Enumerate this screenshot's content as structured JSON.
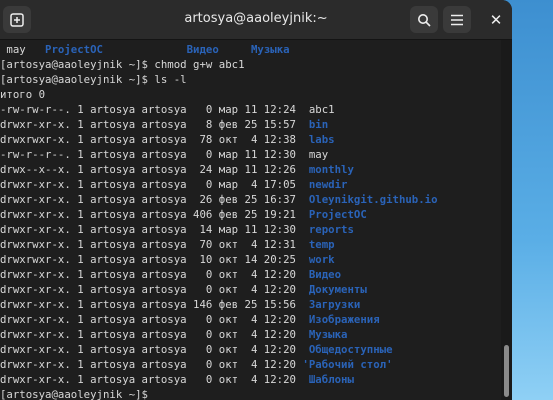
{
  "window": {
    "title": "artosya@aaoleyjnik:~",
    "icons": {
      "new_tab": "new-tab-icon",
      "search": "search-icon",
      "menu": "hamburger-menu-icon",
      "close": "close-icon"
    }
  },
  "colors": {
    "directory": "#2a63b8",
    "text": "#d8d8d8",
    "background": "#1e1e1e"
  },
  "terminal": {
    "lines": [
      [
        {
          "t": " may   "
        },
        {
          "t": "ProjectOC",
          "c": "blue"
        },
        {
          "t": "             "
        },
        {
          "t": "Видео",
          "c": "blue"
        },
        {
          "t": "     "
        },
        {
          "t": "Музыка",
          "c": "blue"
        }
      ],
      [
        {
          "t": "[artosya@aaoleyjnik ~]$ chmod g+w abc1"
        }
      ],
      [
        {
          "t": "[artosya@aaoleyjnik ~]$ ls -l"
        }
      ],
      [
        {
          "t": "итого 0"
        }
      ],
      [
        {
          "t": "-rw-rw-r--. 1 artosya artosya   0 мар 11 12:24  "
        },
        {
          "t": "abc1"
        }
      ],
      [
        {
          "t": "drwxr-xr-x. 1 artosya artosya   8 фев 25 15:57  "
        },
        {
          "t": "bin",
          "c": "blue"
        }
      ],
      [
        {
          "t": "drwxrwxr-x. 1 artosya artosya  78 окт  4 12:38  "
        },
        {
          "t": "labs",
          "c": "blue"
        }
      ],
      [
        {
          "t": "-rw-r--r--. 1 artosya artosya   0 мар 11 12:30  "
        },
        {
          "t": "may"
        }
      ],
      [
        {
          "t": "drwx--x--x. 1 artosya artosya  24 мар 11 12:26  "
        },
        {
          "t": "monthly",
          "c": "blue"
        }
      ],
      [
        {
          "t": "drwxr-xr-x. 1 artosya artosya   0 мар  4 17:05  "
        },
        {
          "t": "newdir",
          "c": "blue"
        }
      ],
      [
        {
          "t": "drwxr-xr-x. 1 artosya artosya  26 фев 25 16:37  "
        },
        {
          "t": "Oleynikgit.github.io",
          "c": "blue"
        }
      ],
      [
        {
          "t": "drwxr-xr-x. 1 artosya artosya 406 фев 25 19:21  "
        },
        {
          "t": "ProjectOC",
          "c": "blue"
        }
      ],
      [
        {
          "t": "drwxr-xr-x. 1 artosya artosya  14 мар 11 12:30  "
        },
        {
          "t": "reports",
          "c": "blue"
        }
      ],
      [
        {
          "t": "drwxrwxr-x. 1 artosya artosya  70 окт  4 12:31  "
        },
        {
          "t": "temp",
          "c": "blue"
        }
      ],
      [
        {
          "t": "drwxrwxr-x. 1 artosya artosya  10 окт 14 20:25  "
        },
        {
          "t": "work",
          "c": "blue"
        }
      ],
      [
        {
          "t": "drwxr-xr-x. 1 artosya artosya   0 окт  4 12:20  "
        },
        {
          "t": "Видео",
          "c": "blue"
        }
      ],
      [
        {
          "t": "drwxr-xr-x. 1 artosya artosya   0 окт  4 12:20  "
        },
        {
          "t": "Документы",
          "c": "blue"
        }
      ],
      [
        {
          "t": "drwxr-xr-x. 1 artosya artosya 146 фев 25 15:56  "
        },
        {
          "t": "Загрузки",
          "c": "blue"
        }
      ],
      [
        {
          "t": "drwxr-xr-x. 1 artosya artosya   0 окт  4 12:20  "
        },
        {
          "t": "Изображения",
          "c": "blue"
        }
      ],
      [
        {
          "t": "drwxr-xr-x. 1 artosya artosya   0 окт  4 12:20  "
        },
        {
          "t": "Музыка",
          "c": "blue"
        }
      ],
      [
        {
          "t": "drwxr-xr-x. 1 artosya artosya   0 окт  4 12:20  "
        },
        {
          "t": "Общедоступные",
          "c": "blue"
        }
      ],
      [
        {
          "t": "drwxr-xr-x. 1 artosya artosya   0 окт  4 12:20 "
        },
        {
          "t": "'Рабочий стол'",
          "c": "blue"
        }
      ],
      [
        {
          "t": "drwxr-xr-x. 1 artosya artosya   0 окт  4 12:20  "
        },
        {
          "t": "Шаблоны",
          "c": "blue"
        }
      ],
      [
        {
          "t": "[artosya@aaoleyjnik ~]$ "
        }
      ]
    ]
  }
}
